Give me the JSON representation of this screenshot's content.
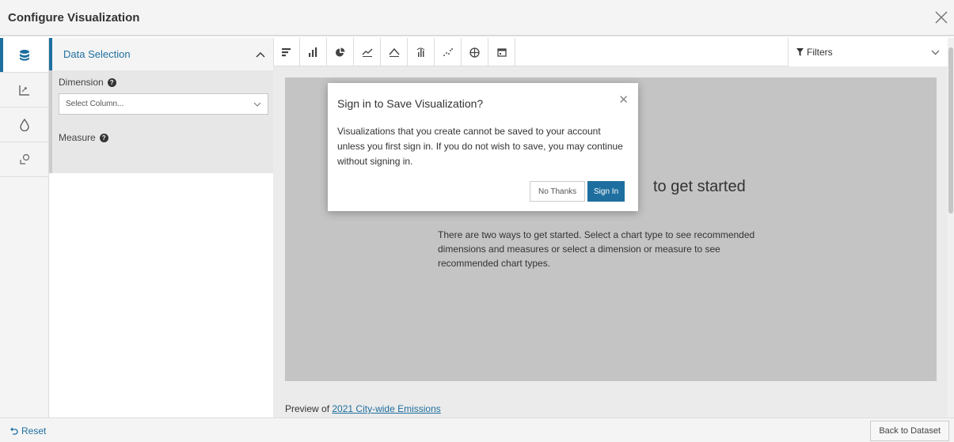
{
  "header": {
    "title": "Configure Visualization",
    "close_icon": "close-icon"
  },
  "rail": [
    {
      "name": "database-icon"
    },
    {
      "name": "chart-axis-icon"
    },
    {
      "name": "drop-icon"
    },
    {
      "name": "chat-icon"
    }
  ],
  "side_panel": {
    "section_label": "Data Selection",
    "dimension_label": "Dimension",
    "dimension_placeholder": "Select Column...",
    "measure_label": "Measure"
  },
  "toolbar": {
    "chart_types": [
      "bar-horizontal-icon",
      "column-icon",
      "pie-icon",
      "line-icon",
      "area-icon",
      "histogram-icon",
      "scatter-icon",
      "map-icon",
      "calendar-icon"
    ],
    "filters_label": "Filters"
  },
  "main": {
    "get_started_heading": "to get started",
    "get_started_text": "There are two ways to get started. Select a chart type to see recommended dimensions and measures or select a dimension or measure to see recommended chart types.",
    "preview_prefix": "Preview of",
    "preview_link": "2021 City-wide Emissions"
  },
  "footer": {
    "reset_label": "Reset",
    "back_label": "Back to Dataset"
  },
  "modal": {
    "title": "Sign in to Save Visualization?",
    "body": "Visualizations that you create cannot be saved to your account unless you first sign in. If you do not wish to save, you may continue without signing in.",
    "no_thanks_label": "No Thanks",
    "sign_in_label": "Sign In"
  },
  "colors": {
    "accent": "#1e6f9f"
  }
}
